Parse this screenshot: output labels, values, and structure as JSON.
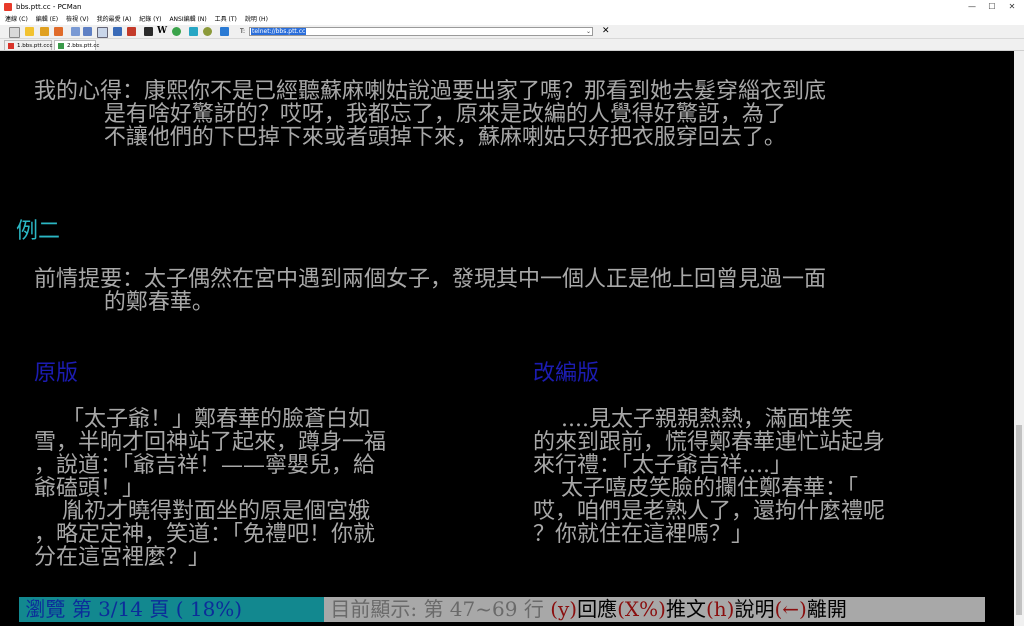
{
  "window": {
    "title": "bbs.ptt.cc - PCMan",
    "minimize": "—",
    "maximize": "☐",
    "close": "✕"
  },
  "menu": [
    "連線 (C)",
    "編輯 (E)",
    "檢視 (V)",
    "我的最愛 (A)",
    "紀錄 (Y)",
    "ANSI編輯 (N)",
    "工具 (T)",
    "說明 (H)"
  ],
  "toolbar": {
    "address_label": "T:",
    "address_value": "telnet://bbs.ptt.cc",
    "close_glyph": "✕"
  },
  "tabs": [
    {
      "label": "1.bbs.ptt.ccc",
      "active": false
    },
    {
      "label": "2.bbs.ptt.cc",
      "active": true
    }
  ],
  "terminal": {
    "line1": "  我的心得：康熙你不是已經聽蘇麻喇姑說過要出家了嗎？那看到她去髮穿緇衣到底",
    "line2": "            是有啥好驚訝的？哎呀，我都忘了，原來是改編的人覺得好驚訝，為了",
    "line3": "            不讓他們的下巴掉下來或者頭掉下來，蘇麻喇姑只好把衣服穿回去了。",
    "example": " 例二",
    "line4": "  前情提要：太子偶然在宮中遇到兩個女子，發現其中一個人正是他上回曾見過一面",
    "line5": "            的鄭春華。",
    "left_heading": "  原版",
    "right_heading": "改編版",
    "left": [
      "      「太子爺！」鄭春華的臉蒼白如",
      "  雪，半晌才回神站了起來，蹲身一福",
      "  ，說道：「爺吉祥！——寧嬰兒，給",
      "  爺磕頭！」",
      "      胤礽才曉得對面坐的原是個宮娥",
      "  ，略定定神，笑道：「免禮吧！你就",
      "  分在這宮裡麼？」"
    ],
    "right": [
      "    ....見太子親親熱熱，滿面堆笑",
      "的來到跟前，慌得鄭春華連忙站起身",
      "來行禮：「太子爺吉祥....」",
      "    太子嘻皮笑臉的攔住鄭春華：「",
      "哎，咱們是老熟人了，還拘什麼禮呢",
      "？你就住在這裡嗎？」"
    ]
  },
  "status_bar": {
    "browse": " 瀏覽 第 3/14 頁 ( 18%) ",
    "display": " 目前顯示: 第 47~69 行 ",
    "y": "(y)",
    "reply": "回應",
    "x": "(X%)",
    "push": "推文",
    "h": "(h)",
    "help": "說明",
    "left": "(←)",
    "leave": "離開"
  }
}
